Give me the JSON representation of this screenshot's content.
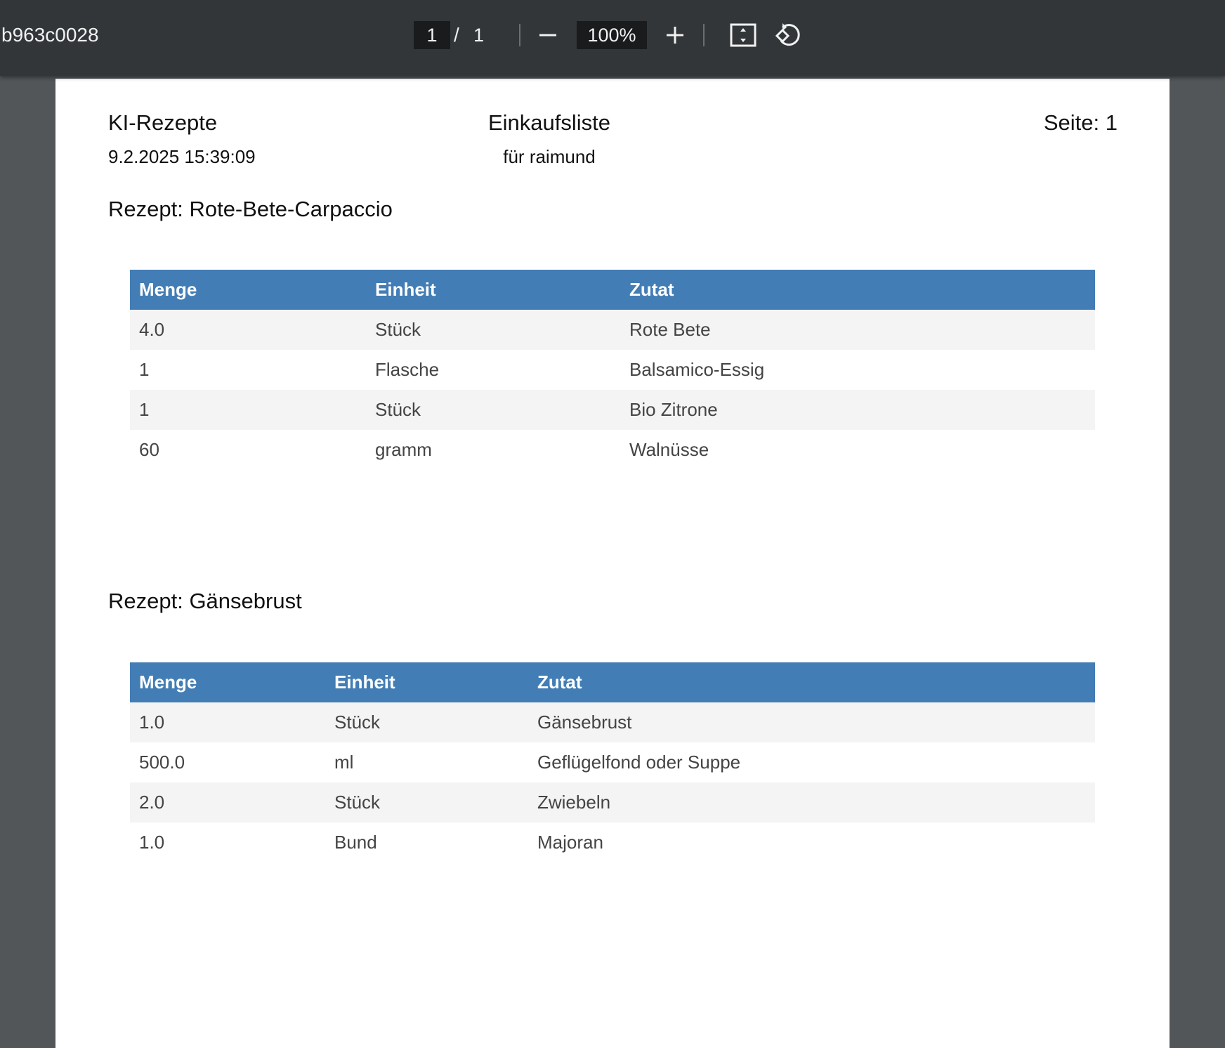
{
  "viewer": {
    "document_title": "b963c0028",
    "current_page": "1",
    "page_separator": "/",
    "total_pages": "1",
    "zoom": "100%"
  },
  "header": {
    "app_name": "KI-Rezepte",
    "datetime": "9.2.2025 15:39:09",
    "list_title": "Einkaufsliste",
    "for_user": "für raimund",
    "page_label": "Seite: 1"
  },
  "recipes": [
    {
      "title": "Rezept: Rote-Bete-Carpaccio",
      "columns": [
        "Menge",
        "Einheit",
        "Zutat"
      ],
      "rows": [
        [
          "4.0",
          "Stück",
          "Rote Bete"
        ],
        [
          "1",
          "Flasche",
          "Balsamico-Essig"
        ],
        [
          "1",
          "Stück",
          "Bio Zitrone"
        ],
        [
          "60",
          "gramm",
          "Walnüsse"
        ]
      ]
    },
    {
      "title": "Rezept: Gänsebrust",
      "columns": [
        "Menge",
        "Einheit",
        "Zutat"
      ],
      "rows": [
        [
          "1.0",
          "Stück",
          "Gänsebrust"
        ],
        [
          "500.0",
          "ml",
          "Geflügelfond oder Suppe"
        ],
        [
          "2.0",
          "Stück",
          "Zwiebeln"
        ],
        [
          "1.0",
          "Bund",
          "Majoran"
        ]
      ]
    }
  ],
  "colors": {
    "toolbar_bg": "#323639",
    "viewer_bg": "#525659",
    "table_header": "#437db5",
    "row_stripe": "#f4f4f4"
  }
}
